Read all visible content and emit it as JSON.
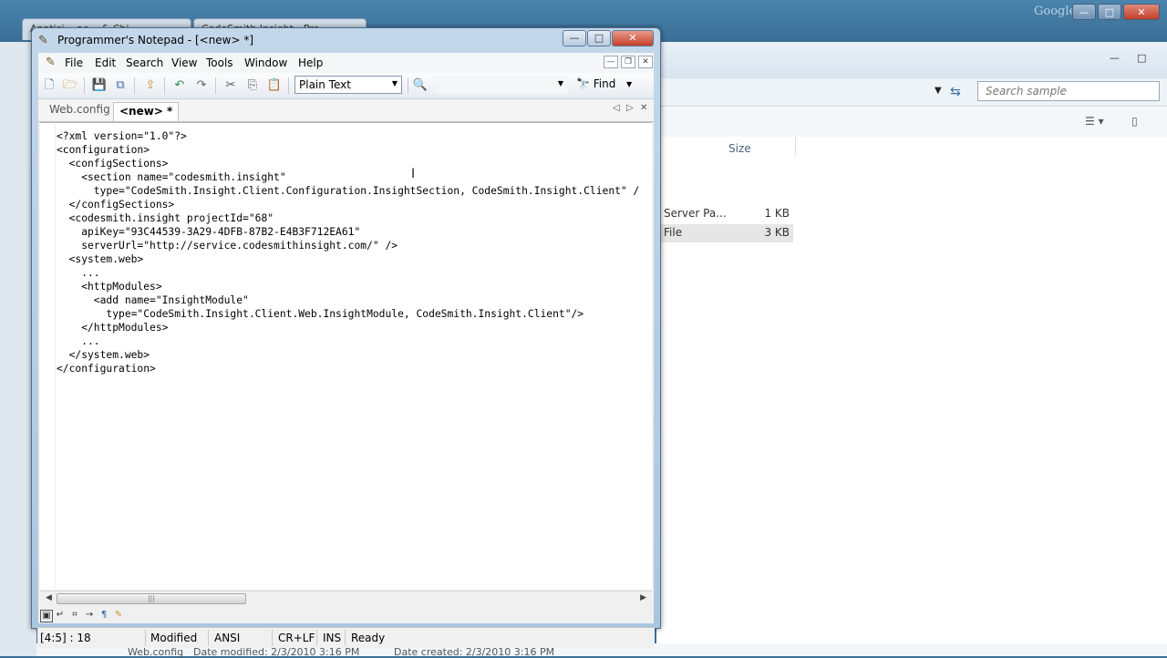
{
  "background": {
    "tabs": [
      "Anatisi... ao... & Chi...",
      "CodeSmith Insight - Pro..."
    ],
    "google_label": "Google",
    "explorer": {
      "search_placeholder": "Search sample",
      "column_size": "Size",
      "files": [
        {
          "name": "Server Pa...",
          "size": "1 KB",
          "selected": false
        },
        {
          "name": "File",
          "size": "3 KB",
          "selected": true
        }
      ],
      "details_bar": {
        "file_name": "Web.config",
        "date_modified": "Date modified: 2/3/2010 3:16 PM",
        "date_created": "Date created: 2/3/2010 3:16 PM"
      }
    }
  },
  "window": {
    "title": "Programmer's Notepad - [<new> *]",
    "app_icon": "pen-notepad-icon",
    "buttons": {
      "minimize": "—",
      "maximize": "□",
      "close": "✕"
    }
  },
  "menu": {
    "items": [
      "File",
      "Edit",
      "Search",
      "View",
      "Tools",
      "Window",
      "Help"
    ]
  },
  "toolbar": {
    "scheme": "Plain Text",
    "find_label": "Find",
    "find_value": ""
  },
  "tabs": [
    {
      "label": "Web.config",
      "active": false
    },
    {
      "label": "<new> *",
      "active": true
    }
  ],
  "editor": {
    "lines": [
      "<?xml version=\"1.0\"?>",
      "<configuration>",
      "  <configSections>",
      "    <section name=\"codesmith.insight\"",
      "      type=\"CodeSmith.Insight.Client.Configuration.InsightSection, CodeSmith.Insight.Client\" /",
      "  </configSections>",
      "  <codesmith.insight projectId=\"68\"",
      "    apiKey=\"93C44539-3A29-4DFB-87B2-E4B3F712EA61\"",
      "    serverUrl=\"http://service.codesmithinsight.com/\" />",
      "  <system.web>",
      "    ...",
      "    <httpModules>",
      "      <add name=\"InsightModule\"",
      "        type=\"CodeSmith.Insight.Client.Web.InsightModule, CodeSmith.Insight.Client\"/>",
      "    </httpModules>",
      "    ...",
      "  </system.web>",
      "</configuration>"
    ]
  },
  "status": {
    "position": "[4:5] : 18",
    "modified": "Modified",
    "encoding": "ANSI",
    "line_endings": "CR+LF",
    "insert_mode": "INS",
    "state": "Ready"
  }
}
